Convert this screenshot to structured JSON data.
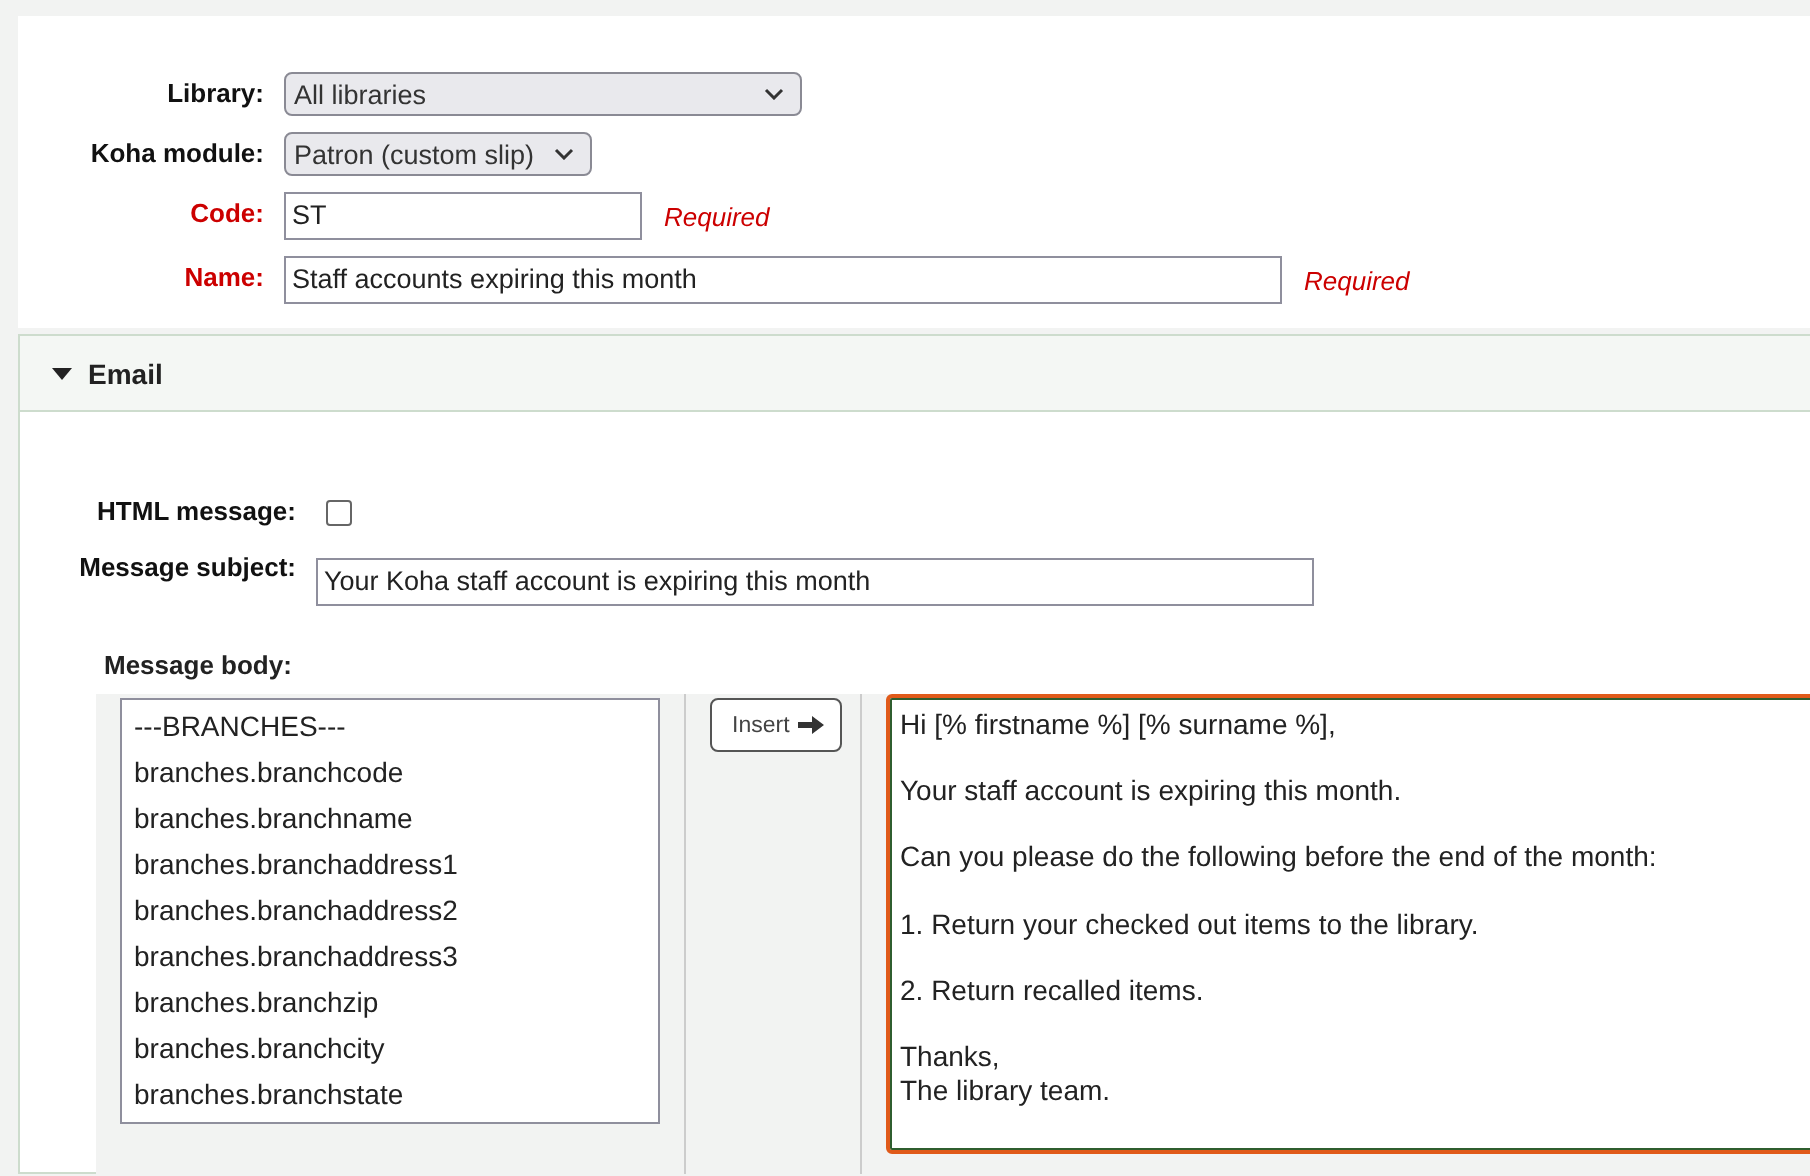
{
  "form": {
    "fields": [
      {
        "kind": "select",
        "label": "Library:",
        "value": "All libraries",
        "required": false
      },
      {
        "kind": "select",
        "label": "Koha module:",
        "value": "Patron (custom slip)",
        "required": false
      },
      {
        "kind": "text",
        "label": "Code:",
        "value": "ST",
        "required": true,
        "note": "Required"
      },
      {
        "kind": "text",
        "label": "Name:",
        "value": "Staff accounts expiring this month",
        "required": true,
        "note": "Required"
      }
    ]
  },
  "email": {
    "title": "Email",
    "expanded": true,
    "html_message": {
      "label": "HTML message:",
      "checked": false
    },
    "subject": {
      "label": "Message subject:",
      "value": "Your Koha staff account is expiring this month"
    },
    "body_label": "Message body:",
    "placeholders": [
      "---BRANCHES---",
      "branches.branchcode",
      "branches.branchname",
      "branches.branchaddress1",
      "branches.branchaddress2",
      "branches.branchaddress3",
      "branches.branchzip",
      "branches.branchcity",
      "branches.branchstate"
    ],
    "insert_button": "Insert",
    "body": "Hi [% firstname %] [% surname %],\n\nYour staff account is expiring this month.\n\nCan you please do the following before the end of the month:\n\n1. Return your checked out items to the library.\n\n2. Return recalled items.\n\nThanks,\nThe library team."
  }
}
